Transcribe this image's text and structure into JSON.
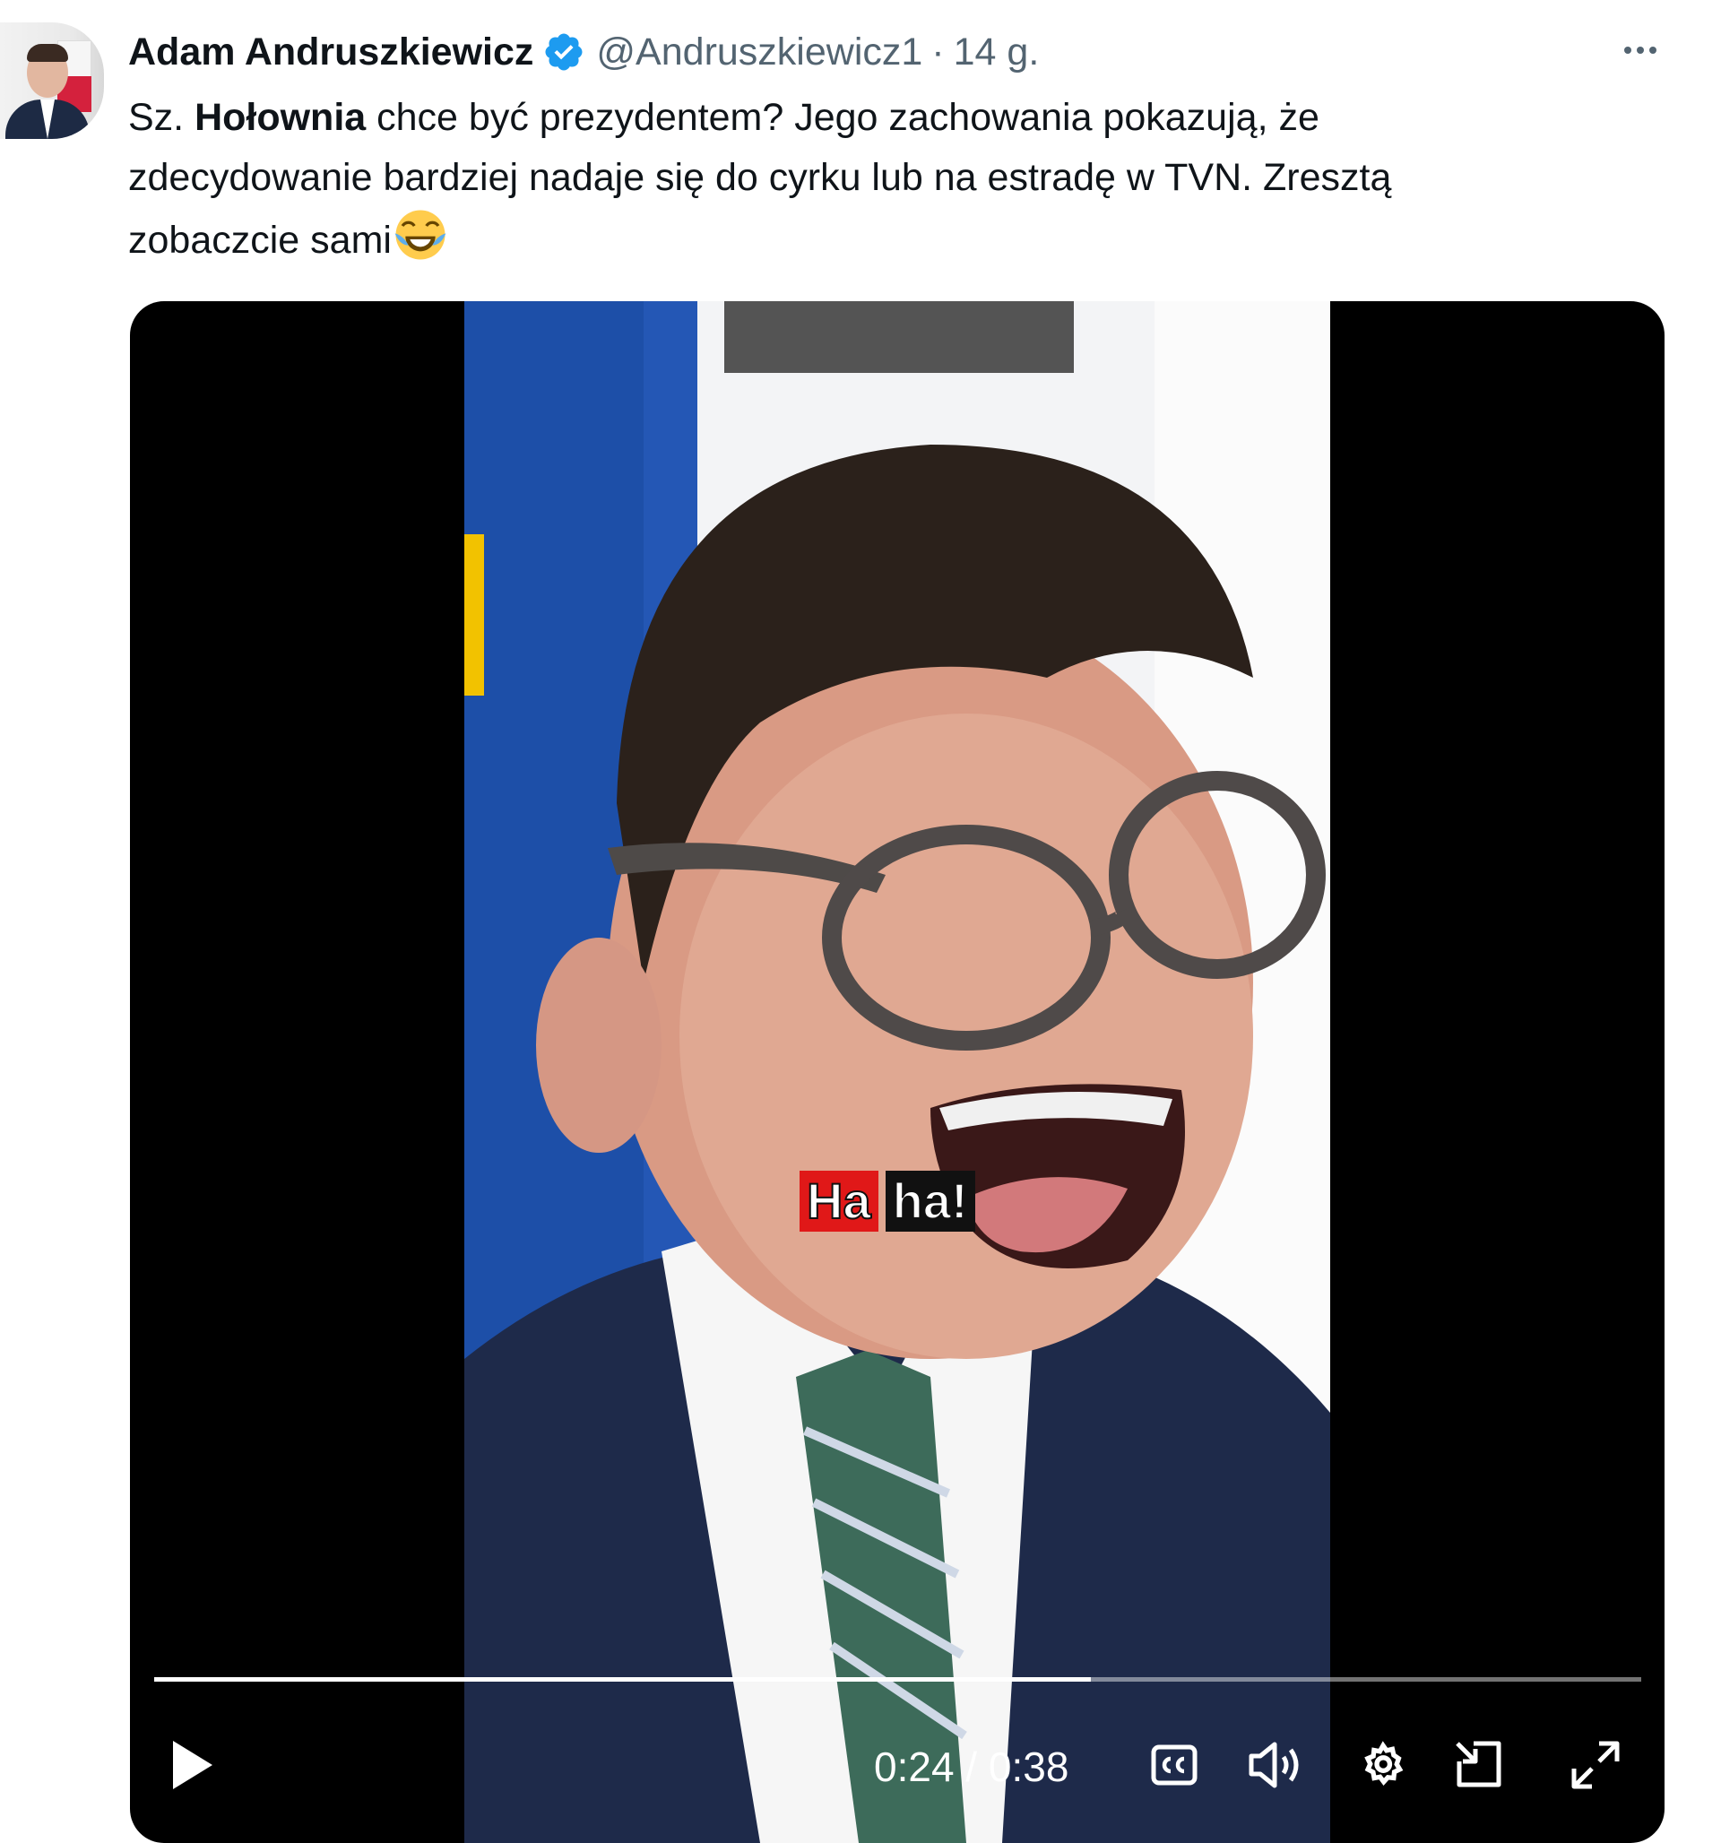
{
  "author": {
    "display_name": "Adam Andruszkiewicz",
    "handle": "@Andruszkiewicz1",
    "separator": "·",
    "timestamp": "14 g."
  },
  "tweet": {
    "lines": [
      {
        "pre": "Sz. ",
        "bold": "Hołownia",
        "post": " chce być prezydentem? Jego zachowania pokazują, że"
      },
      {
        "text": "zdecydowanie bardziej nadaje się do cyrku lub na estradę w TVN. Zresztą"
      },
      {
        "text": "zobaczcie sami"
      }
    ],
    "emoji": "face-with-tears-of-joy"
  },
  "video": {
    "caption_words": [
      "Ha",
      "ha!"
    ],
    "current_time": "0:24",
    "duration": "0:38",
    "time_display": "0:24 / 0:38",
    "progress_fraction": 0.63
  },
  "icons": {
    "verified": "verified-badge-icon",
    "more": "more-options-icon",
    "play": "play-icon",
    "cc": "closed-captions-icon",
    "volume": "volume-icon",
    "settings": "gear-icon",
    "pip": "picture-in-picture-icon",
    "fullscreen": "fullscreen-icon"
  },
  "colors": {
    "verified_blue": "#1d9bf0",
    "secondary_text": "#536471",
    "caption_red": "#e01818"
  }
}
